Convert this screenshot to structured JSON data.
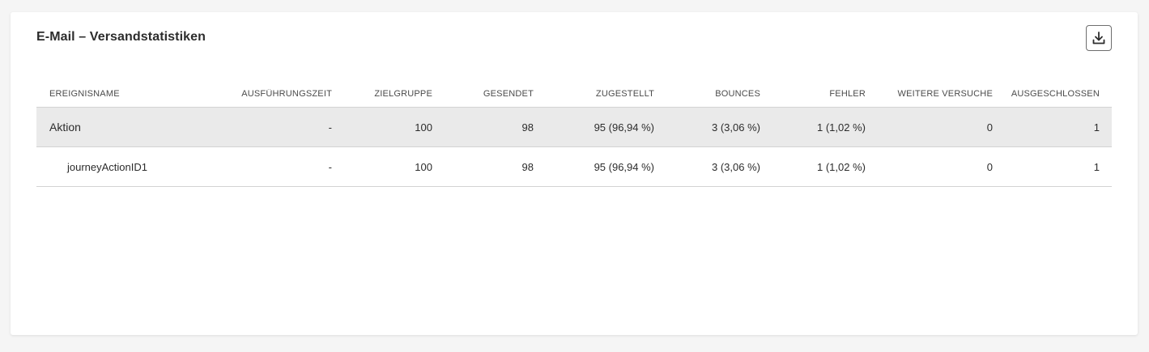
{
  "card": {
    "title": "E-Mail – Versandstatistiken",
    "download_icon": "download-icon"
  },
  "table": {
    "columns": [
      "EREIGNISNAME",
      "AUSFÜHRUNGSZEIT",
      "ZIELGRUPPE",
      "GESENDET",
      "ZUGESTELLT",
      "BOUNCES",
      "FEHLER",
      "WEITERE VERSUCHE",
      "AUSGESCHLOSSEN"
    ],
    "rows": [
      {
        "name": "Aktion",
        "time": "-",
        "zielgruppe": "100",
        "gesendet": "98",
        "zugestellt": "95 (96,94 %)",
        "bounces": "3 (3,06 %)",
        "fehler": "1 (1,02 %)",
        "weitere": "0",
        "ausgeschlossen": "1"
      },
      {
        "name": "journeyActionID1",
        "time": "-",
        "zielgruppe": "100",
        "gesendet": "98",
        "zugestellt": "95 (96,94 %)",
        "bounces": "3 (3,06 %)",
        "fehler": "1 (1,02 %)",
        "weitere": "0",
        "ausgeschlossen": "1"
      }
    ]
  },
  "colors": {
    "group_row_bg": "#eaeaea",
    "divider": "#d3d3d3",
    "text": "#2c2c2c"
  }
}
